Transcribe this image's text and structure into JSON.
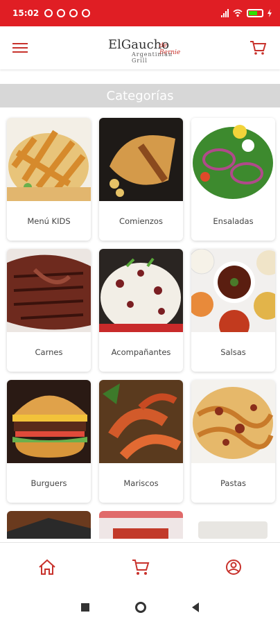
{
  "status": {
    "time": "15:02"
  },
  "header": {
    "logo_main": "ElGaucho",
    "logo_script": "de Bernie",
    "logo_sub": "Argentinian Grill"
  },
  "section": {
    "title": "Categorías"
  },
  "categories": [
    {
      "label": "Menú KIDS",
      "image": "pasta-dish"
    },
    {
      "label": "Comienzos",
      "image": "empanada"
    },
    {
      "label": "Ensaladas",
      "image": "salad"
    },
    {
      "label": "Carnes",
      "image": "steak"
    },
    {
      "label": "Acompañantes",
      "image": "rice"
    },
    {
      "label": "Salsas",
      "image": "sauces"
    },
    {
      "label": "Burguers",
      "image": "burger"
    },
    {
      "label": "Mariscos",
      "image": "shrimp"
    },
    {
      "label": "Pastas",
      "image": "pasta-bolognese"
    }
  ],
  "colors": {
    "brand_red": "#e01e24",
    "icon_red": "#c8322c",
    "bar_gray": "#d7d7d7"
  },
  "nav": {
    "items": [
      "home-icon",
      "cart-icon",
      "profile-icon"
    ]
  }
}
